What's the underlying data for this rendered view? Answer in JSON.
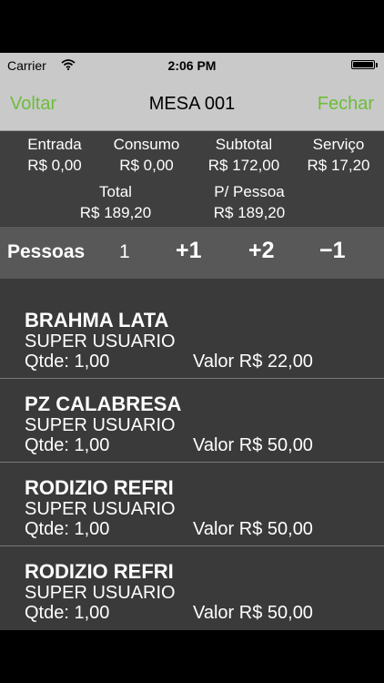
{
  "status_bar": {
    "carrier": "Carrier",
    "time": "2:06 PM"
  },
  "nav": {
    "back": "Voltar",
    "title": "MESA 001",
    "close": "Fechar"
  },
  "summary": {
    "entrada": {
      "label": "Entrada",
      "value": "R$ 0,00"
    },
    "consumo": {
      "label": "Consumo",
      "value": "R$ 0,00"
    },
    "subtotal": {
      "label": "Subtotal",
      "value": "R$ 172,00"
    },
    "servico": {
      "label": "Serviço",
      "value": "R$ 17,20"
    },
    "total": {
      "label": "Total",
      "value": "R$ 189,20"
    },
    "por_pessoa": {
      "label": "P/ Pessoa",
      "value": "R$ 189,20"
    }
  },
  "pessoas": {
    "label": "Pessoas",
    "count": "1",
    "plus1": "+1",
    "plus2": "+2",
    "minus1": "−1"
  },
  "items": [
    {
      "name": "BRAHMA LATA",
      "user": "SUPER USUARIO",
      "qty": "Qtde: 1,00",
      "valor": "Valor R$ 22,00"
    },
    {
      "name": "PZ CALABRESA",
      "user": "SUPER USUARIO",
      "qty": "Qtde: 1,00",
      "valor": "Valor R$ 50,00"
    },
    {
      "name": "RODIZIO REFRI",
      "user": "SUPER USUARIO",
      "qty": "Qtde: 1,00",
      "valor": "Valor R$ 50,00"
    },
    {
      "name": "RODIZIO REFRI",
      "user": "SUPER USUARIO",
      "qty": "Qtde: 1,00",
      "valor": "Valor R$ 50,00"
    }
  ],
  "colors": {
    "accent": "#6dbd3a",
    "bar": "#c9c9c9",
    "background": "#3a3a3a"
  },
  "icons": [
    "wifi-icon",
    "battery-icon"
  ]
}
